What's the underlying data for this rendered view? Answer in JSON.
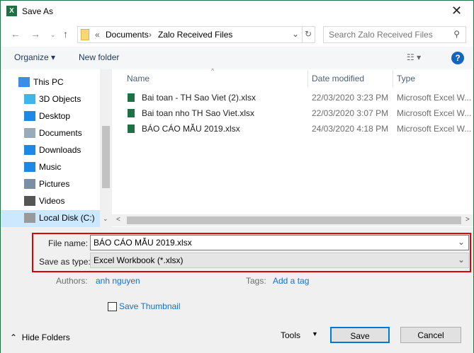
{
  "window": {
    "title": "Save As",
    "app_icon": "X"
  },
  "address": {
    "path": [
      "Documents",
      "Zalo Received Files"
    ],
    "overflow": "«",
    "search_placeholder": "Search Zalo Received Files"
  },
  "toolbar": {
    "organize": "Organize",
    "new_folder": "New folder",
    "help": "?"
  },
  "nav": {
    "items": [
      {
        "label": "This PC",
        "icon": "pc-icon"
      },
      {
        "label": "3D Objects",
        "icon": "cube-icon"
      },
      {
        "label": "Desktop",
        "icon": "desktop-icon"
      },
      {
        "label": "Documents",
        "icon": "documents-icon"
      },
      {
        "label": "Downloads",
        "icon": "downloads-icon"
      },
      {
        "label": "Music",
        "icon": "music-icon"
      },
      {
        "label": "Pictures",
        "icon": "pictures-icon"
      },
      {
        "label": "Videos",
        "icon": "videos-icon"
      },
      {
        "label": "Local Disk (C:)",
        "icon": "disk-icon"
      }
    ]
  },
  "files": {
    "columns": [
      "Name",
      "Date modified",
      "Type"
    ],
    "rows": [
      {
        "name": "Bai toan - TH Sao Viet (2).xlsx",
        "date": "22/03/2020 3:23 PM",
        "type": "Microsoft Excel W..."
      },
      {
        "name": "Bai toan nho TH Sao Viet.xlsx",
        "date": "22/03/2020 3:07 PM",
        "type": "Microsoft Excel W..."
      },
      {
        "name": "BÁO CÁO MẪU 2019.xlsx",
        "date": "24/03/2020 4:18 PM",
        "type": "Microsoft Excel W..."
      }
    ]
  },
  "form": {
    "file_name_label": "File name:",
    "file_name": "BÁO CÁO MẪU 2019.xlsx",
    "type_label": "Save as type:",
    "type_value": "Excel Workbook (*.xlsx)",
    "authors_label": "Authors:",
    "authors": "anh nguyen",
    "tags_label": "Tags:",
    "tags": "Add a tag",
    "thumbnail": "Save Thumbnail"
  },
  "footer": {
    "hide_folders": "Hide Folders",
    "tools": "Tools",
    "save": "Save",
    "cancel": "Cancel"
  },
  "colors": {
    "highlight": "#e00000",
    "excel": "#1e7145",
    "link": "#1a6fc5"
  }
}
